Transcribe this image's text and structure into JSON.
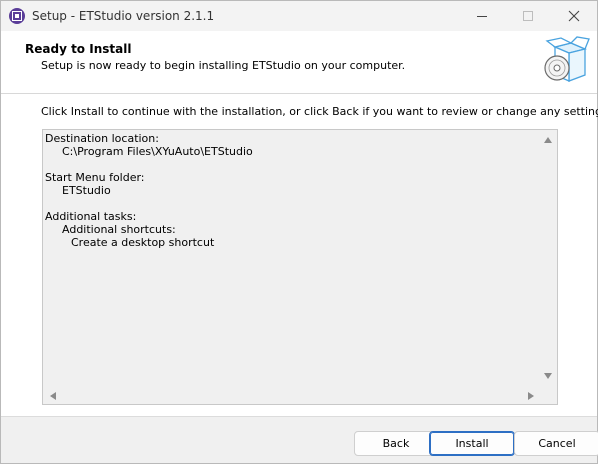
{
  "window": {
    "title": "Setup - ETStudio version 2.1.1",
    "app_icon": "etstudio-app-icon",
    "controls": [
      "minimize-icon",
      "maximize-icon",
      "close-icon"
    ]
  },
  "header": {
    "title": "Ready to Install",
    "subtitle": "Setup is now ready to begin installing ETStudio on your computer.",
    "icon": "setup-box-cd-icon"
  },
  "body": {
    "instruction": "Click Install to continue with the installation, or click Back if you want to review or change any settings.",
    "memo": {
      "destination_label": "Destination location:",
      "destination_value": "C:\\Program Files\\XYuAuto\\ETStudio",
      "startmenu_label": "Start Menu folder:",
      "startmenu_value": "ETStudio",
      "tasks_label": "Additional tasks:",
      "shortcuts_label": "Additional shortcuts:",
      "desktop_shortcut": "Create a desktop shortcut"
    }
  },
  "buttons": {
    "back": "Back",
    "install": "Install",
    "cancel": "Cancel"
  },
  "colors": {
    "accent": "#2d6fc4",
    "icon_purple": "#5a3d98",
    "box_blue": "#4aa3df"
  }
}
